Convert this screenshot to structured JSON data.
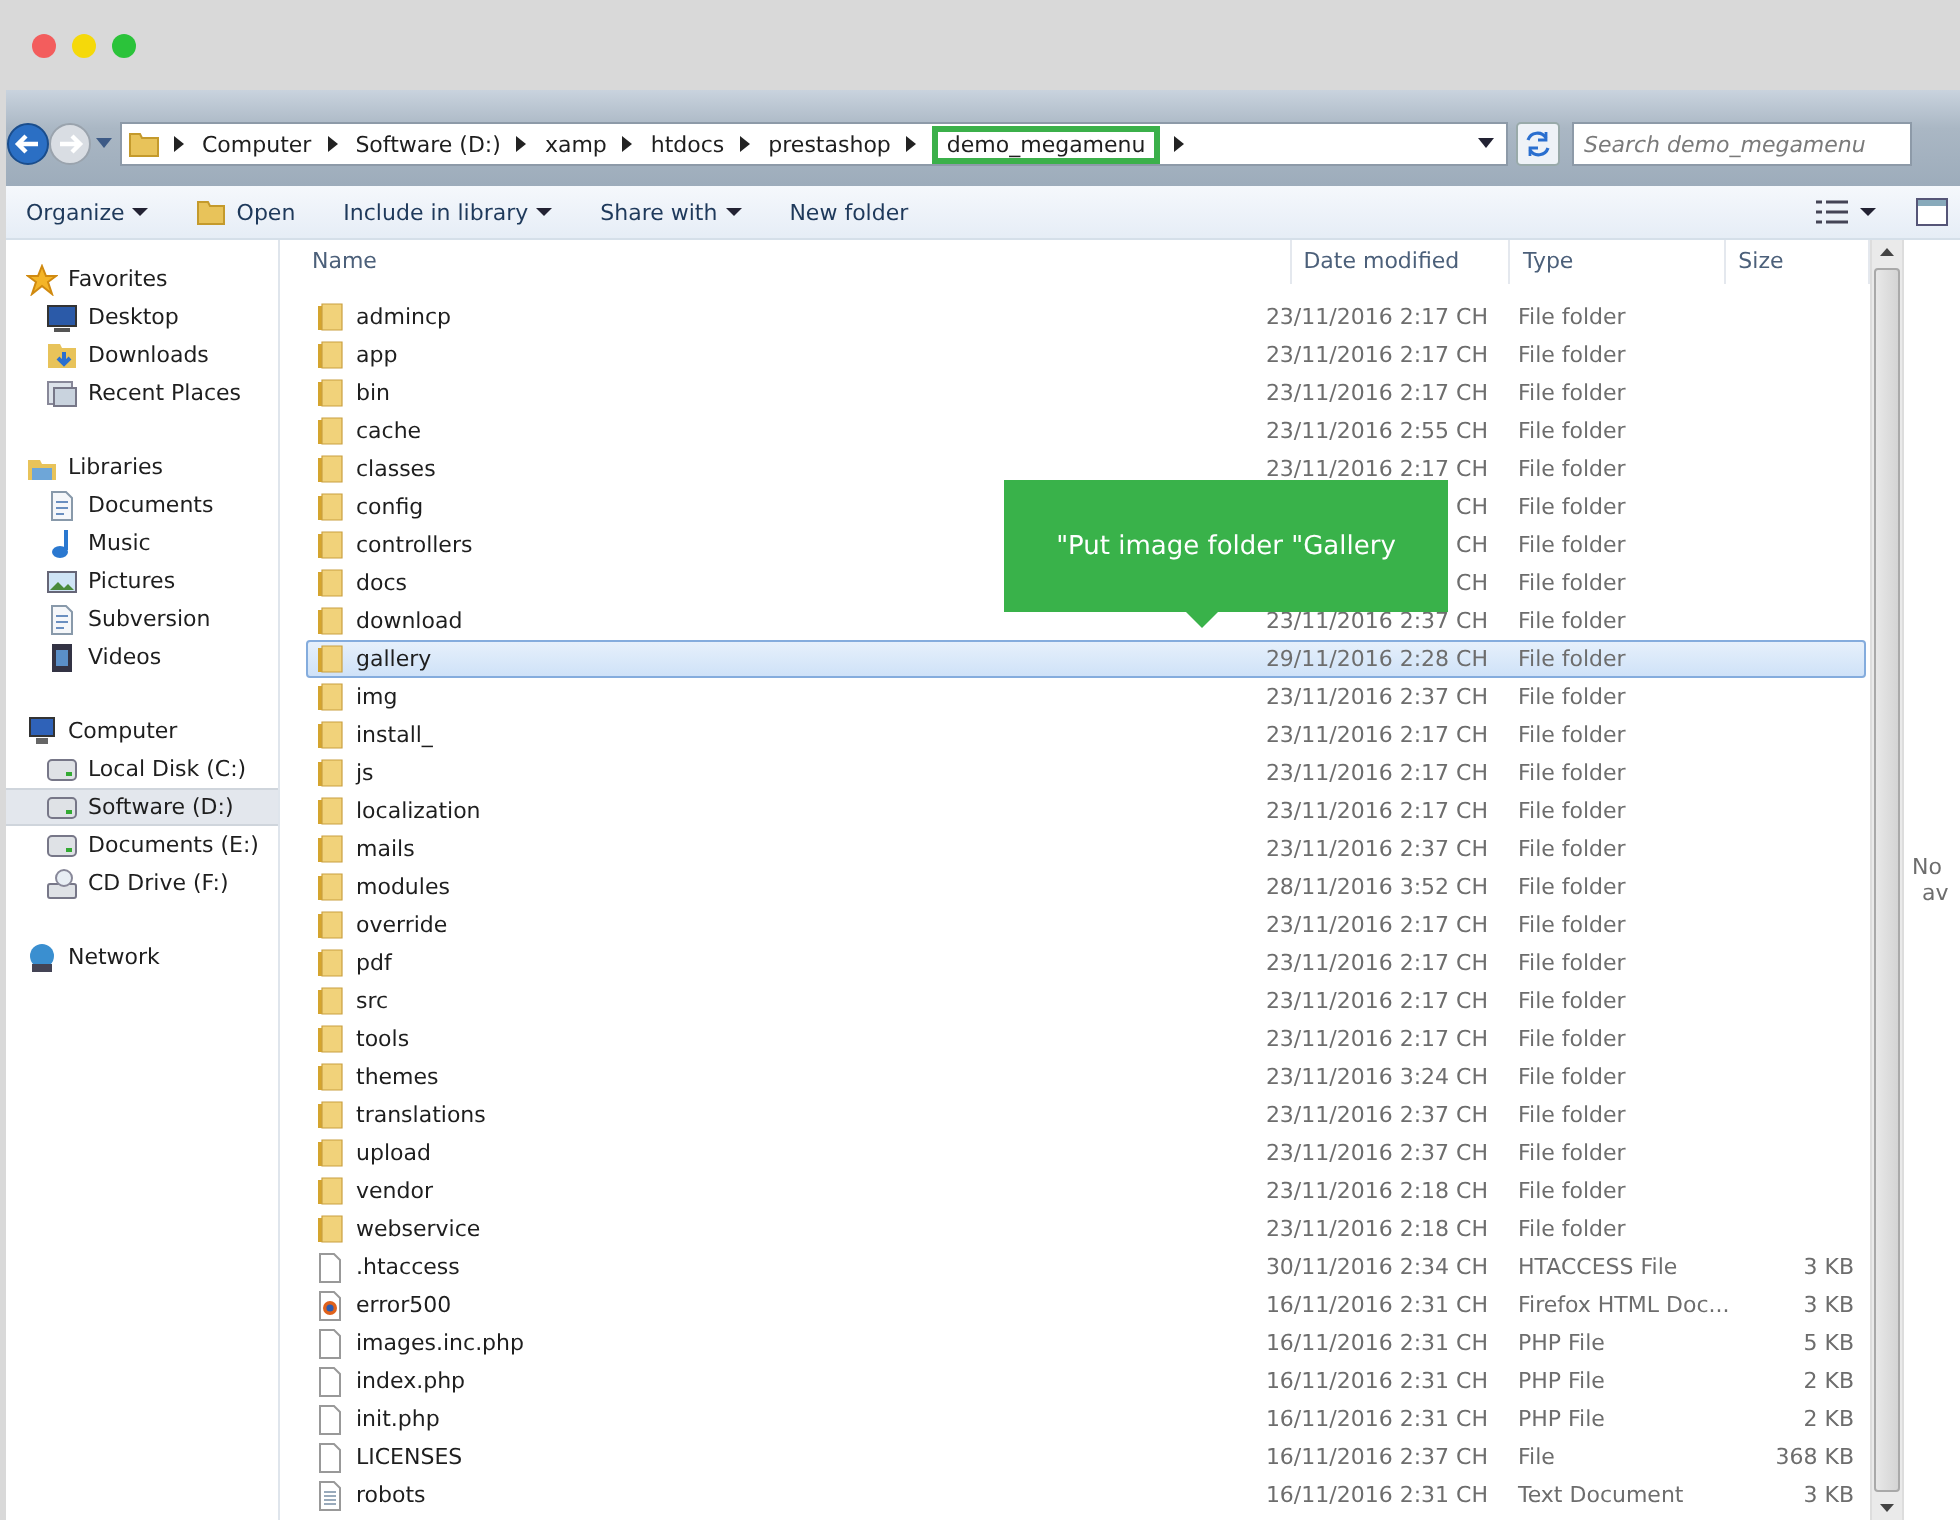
{
  "breadcrumb": [
    {
      "label": "Computer",
      "highlighted": false
    },
    {
      "label": "Software (D:)",
      "highlighted": false
    },
    {
      "label": "xamp",
      "highlighted": false
    },
    {
      "label": "htdocs",
      "highlighted": false
    },
    {
      "label": "prestashop",
      "highlighted": false
    },
    {
      "label": "demo_megamenu",
      "highlighted": true
    }
  ],
  "search": {
    "placeholder": "Search demo_megamenu"
  },
  "toolbar": [
    {
      "label": "Organize",
      "kind": "menu"
    },
    {
      "label": "Open",
      "kind": "open"
    },
    {
      "label": "Include in library",
      "kind": "menu"
    },
    {
      "label": "Share with",
      "kind": "menu"
    },
    {
      "label": "New folder",
      "kind": "plain"
    }
  ],
  "sidebar": [
    {
      "label": "Favorites",
      "kind": "star",
      "children": [
        {
          "label": "Desktop",
          "kind": "monitor",
          "selected": false
        },
        {
          "label": "Downloads",
          "kind": "downloads",
          "selected": false
        },
        {
          "label": "Recent Places",
          "kind": "recent",
          "selected": false
        }
      ]
    },
    {
      "label": "Libraries",
      "kind": "library",
      "children": [
        {
          "label": "Documents",
          "kind": "doc",
          "selected": false
        },
        {
          "label": "Music",
          "kind": "music",
          "selected": false
        },
        {
          "label": "Pictures",
          "kind": "picture",
          "selected": false
        },
        {
          "label": "Subversion",
          "kind": "doc",
          "selected": false
        },
        {
          "label": "Videos",
          "kind": "video",
          "selected": false
        }
      ]
    },
    {
      "label": "Computer",
      "kind": "computer",
      "children": [
        {
          "label": "Local Disk (C:)",
          "kind": "drive",
          "selected": false
        },
        {
          "label": "Software (D:)",
          "kind": "drive",
          "selected": true
        },
        {
          "label": "Documents (E:)",
          "kind": "drive",
          "selected": false
        },
        {
          "label": "CD Drive (F:)",
          "kind": "cd",
          "selected": false
        }
      ]
    },
    {
      "label": "Network",
      "kind": "network"
    }
  ],
  "table": {
    "columns": [
      "Name",
      "Date modified",
      "Type",
      "Size"
    ],
    "rows": [
      {
        "name": "admincp",
        "date": "23/11/2016 2:17 CH",
        "type": "File folder",
        "kind": "folder",
        "selected": false
      },
      {
        "name": "app",
        "date": "23/11/2016 2:17 CH",
        "type": "File folder",
        "kind": "folder",
        "selected": false
      },
      {
        "name": "bin",
        "date": "23/11/2016 2:17 CH",
        "type": "File folder",
        "kind": "folder",
        "selected": false
      },
      {
        "name": "cache",
        "date": "23/11/2016 2:55 CH",
        "type": "File folder",
        "kind": "folder",
        "selected": false
      },
      {
        "name": "classes",
        "date": "23/11/2016 2:17 CH",
        "type": "File folder",
        "kind": "folder",
        "selected": false
      },
      {
        "name": "config",
        "date": "CH",
        "type": "File folder",
        "kind": "folder",
        "selected": false
      },
      {
        "name": "controllers",
        "date": "CH",
        "type": "File folder",
        "kind": "folder",
        "selected": false
      },
      {
        "name": "docs",
        "date": "CH",
        "type": "File folder",
        "kind": "folder",
        "selected": false
      },
      {
        "name": "download",
        "date": "23/11/2016 2:37 CH",
        "type": "File folder",
        "kind": "folder",
        "selected": false
      },
      {
        "name": "gallery",
        "date": "29/11/2016 2:28 CH",
        "type": "File folder",
        "kind": "folder",
        "selected": true
      },
      {
        "name": "img",
        "date": "23/11/2016 2:37 CH",
        "type": "File folder",
        "kind": "folder",
        "selected": false
      },
      {
        "name": "install_",
        "date": "23/11/2016 2:17 CH",
        "type": "File folder",
        "kind": "folder",
        "selected": false
      },
      {
        "name": "js",
        "date": "23/11/2016 2:17 CH",
        "type": "File folder",
        "kind": "folder",
        "selected": false
      },
      {
        "name": "localization",
        "date": "23/11/2016 2:17 CH",
        "type": "File folder",
        "kind": "folder",
        "selected": false
      },
      {
        "name": "mails",
        "date": "23/11/2016 2:37 CH",
        "type": "File folder",
        "kind": "folder",
        "selected": false
      },
      {
        "name": "modules",
        "date": "28/11/2016 3:52 CH",
        "type": "File folder",
        "kind": "folder",
        "selected": false
      },
      {
        "name": "override",
        "date": "23/11/2016 2:17 CH",
        "type": "File folder",
        "kind": "folder",
        "selected": false
      },
      {
        "name": "pdf",
        "date": "23/11/2016 2:17 CH",
        "type": "File folder",
        "kind": "folder",
        "selected": false
      },
      {
        "name": "src",
        "date": "23/11/2016 2:17 CH",
        "type": "File folder",
        "kind": "folder",
        "selected": false
      },
      {
        "name": "tools",
        "date": "23/11/2016 2:17 CH",
        "type": "File folder",
        "kind": "folder",
        "selected": false
      },
      {
        "name": "themes",
        "date": "23/11/2016 3:24 CH",
        "type": "File folder",
        "kind": "folder",
        "selected": false
      },
      {
        "name": "translations",
        "date": "23/11/2016 2:37 CH",
        "type": "File folder",
        "kind": "folder",
        "selected": false
      },
      {
        "name": "upload",
        "date": "23/11/2016 2:37 CH",
        "type": "File folder",
        "kind": "folder",
        "selected": false
      },
      {
        "name": "vendor",
        "date": "23/11/2016 2:18 CH",
        "type": "File folder",
        "kind": "folder",
        "selected": false
      },
      {
        "name": "webservice",
        "date": "23/11/2016 2:18 CH",
        "type": "File folder",
        "kind": "folder",
        "selected": false
      },
      {
        "name": ".htaccess",
        "date": "30/11/2016 2:34 CH",
        "type": "HTACCESS File",
        "size": "3 KB",
        "kind": "file",
        "selected": false
      },
      {
        "name": "error500",
        "date": "16/11/2016 2:31 CH",
        "type": "Firefox HTML Doc...",
        "size": "3 KB",
        "kind": "html",
        "selected": false
      },
      {
        "name": "images.inc.php",
        "date": "16/11/2016 2:31 CH",
        "type": "PHP File",
        "size": "5 KB",
        "kind": "file",
        "selected": false
      },
      {
        "name": "index.php",
        "date": "16/11/2016 2:31 CH",
        "type": "PHP File",
        "size": "2 KB",
        "kind": "file",
        "selected": false
      },
      {
        "name": "init.php",
        "date": "16/11/2016 2:31 CH",
        "type": "PHP File",
        "size": "2 KB",
        "kind": "file",
        "selected": false
      },
      {
        "name": "LICENSES",
        "date": "16/11/2016 2:37 CH",
        "type": "File",
        "size": "368 KB",
        "kind": "file",
        "selected": false
      },
      {
        "name": "robots",
        "date": "16/11/2016 2:31 CH",
        "type": "Text Document",
        "size": "3 KB",
        "kind": "text",
        "selected": false
      }
    ]
  },
  "callout": {
    "text": "\"Put image folder \"Gallery"
  },
  "preview": {
    "line_1": "No",
    "line_2": "av"
  }
}
